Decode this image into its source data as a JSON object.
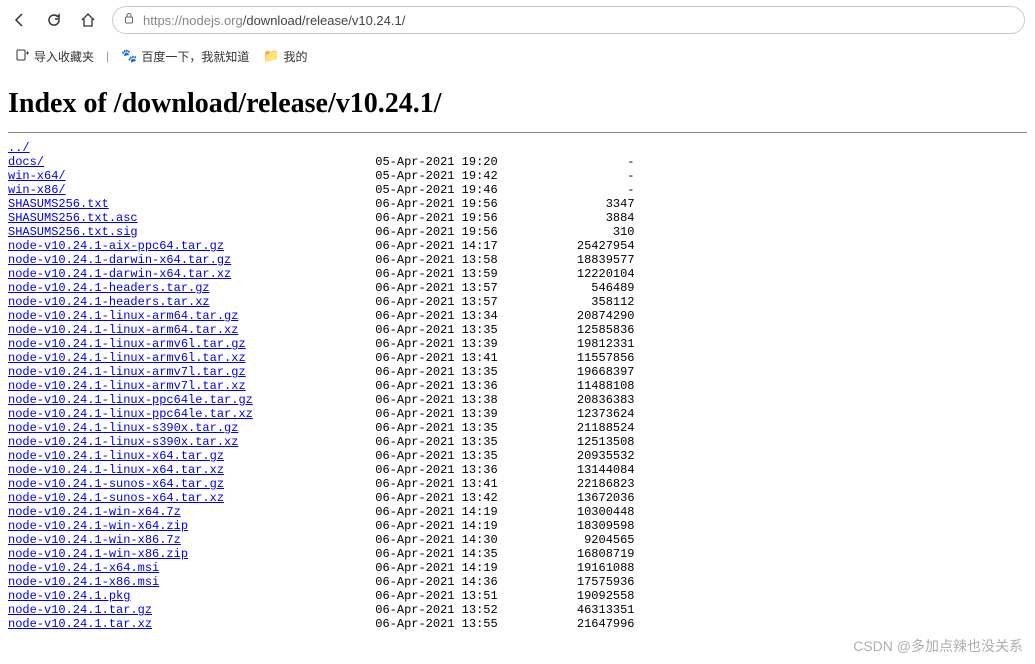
{
  "browser": {
    "url_host": "https://nodejs.org",
    "url_path": "/download/release/v10.24.1/"
  },
  "bookmarks": {
    "import_label": "导入收藏夹",
    "baidu_label": "百度一下，我就知道",
    "mine_label": "我的"
  },
  "page": {
    "title": "Index of /download/release/v10.24.1/"
  },
  "parent_link": "../",
  "files": [
    {
      "name": "docs/",
      "date": "05-Apr-2021 19:20",
      "size": "-"
    },
    {
      "name": "win-x64/",
      "date": "05-Apr-2021 19:42",
      "size": "-"
    },
    {
      "name": "win-x86/",
      "date": "05-Apr-2021 19:46",
      "size": "-"
    },
    {
      "name": "SHASUMS256.txt",
      "date": "06-Apr-2021 19:56",
      "size": "3347"
    },
    {
      "name": "SHASUMS256.txt.asc",
      "date": "06-Apr-2021 19:56",
      "size": "3884"
    },
    {
      "name": "SHASUMS256.txt.sig",
      "date": "06-Apr-2021 19:56",
      "size": "310"
    },
    {
      "name": "node-v10.24.1-aix-ppc64.tar.gz",
      "date": "06-Apr-2021 14:17",
      "size": "25427954"
    },
    {
      "name": "node-v10.24.1-darwin-x64.tar.gz",
      "date": "06-Apr-2021 13:58",
      "size": "18839577"
    },
    {
      "name": "node-v10.24.1-darwin-x64.tar.xz",
      "date": "06-Apr-2021 13:59",
      "size": "12220104"
    },
    {
      "name": "node-v10.24.1-headers.tar.gz",
      "date": "06-Apr-2021 13:57",
      "size": "546489"
    },
    {
      "name": "node-v10.24.1-headers.tar.xz",
      "date": "06-Apr-2021 13:57",
      "size": "358112"
    },
    {
      "name": "node-v10.24.1-linux-arm64.tar.gz",
      "date": "06-Apr-2021 13:34",
      "size": "20874290"
    },
    {
      "name": "node-v10.24.1-linux-arm64.tar.xz",
      "date": "06-Apr-2021 13:35",
      "size": "12585836"
    },
    {
      "name": "node-v10.24.1-linux-armv6l.tar.gz",
      "date": "06-Apr-2021 13:39",
      "size": "19812331"
    },
    {
      "name": "node-v10.24.1-linux-armv6l.tar.xz",
      "date": "06-Apr-2021 13:41",
      "size": "11557856"
    },
    {
      "name": "node-v10.24.1-linux-armv7l.tar.gz",
      "date": "06-Apr-2021 13:35",
      "size": "19668397"
    },
    {
      "name": "node-v10.24.1-linux-armv7l.tar.xz",
      "date": "06-Apr-2021 13:36",
      "size": "11488108"
    },
    {
      "name": "node-v10.24.1-linux-ppc64le.tar.gz",
      "date": "06-Apr-2021 13:38",
      "size": "20836383"
    },
    {
      "name": "node-v10.24.1-linux-ppc64le.tar.xz",
      "date": "06-Apr-2021 13:39",
      "size": "12373624"
    },
    {
      "name": "node-v10.24.1-linux-s390x.tar.gz",
      "date": "06-Apr-2021 13:35",
      "size": "21188524"
    },
    {
      "name": "node-v10.24.1-linux-s390x.tar.xz",
      "date": "06-Apr-2021 13:35",
      "size": "12513508"
    },
    {
      "name": "node-v10.24.1-linux-x64.tar.gz",
      "date": "06-Apr-2021 13:35",
      "size": "20935532"
    },
    {
      "name": "node-v10.24.1-linux-x64.tar.xz",
      "date": "06-Apr-2021 13:36",
      "size": "13144084"
    },
    {
      "name": "node-v10.24.1-sunos-x64.tar.gz",
      "date": "06-Apr-2021 13:41",
      "size": "22186823"
    },
    {
      "name": "node-v10.24.1-sunos-x64.tar.xz",
      "date": "06-Apr-2021 13:42",
      "size": "13672036"
    },
    {
      "name": "node-v10.24.1-win-x64.7z",
      "date": "06-Apr-2021 14:19",
      "size": "10300448"
    },
    {
      "name": "node-v10.24.1-win-x64.zip",
      "date": "06-Apr-2021 14:19",
      "size": "18309598"
    },
    {
      "name": "node-v10.24.1-win-x86.7z",
      "date": "06-Apr-2021 14:30",
      "size": "9204565"
    },
    {
      "name": "node-v10.24.1-win-x86.zip",
      "date": "06-Apr-2021 14:35",
      "size": "16808719"
    },
    {
      "name": "node-v10.24.1-x64.msi",
      "date": "06-Apr-2021 14:19",
      "size": "19161088"
    },
    {
      "name": "node-v10.24.1-x86.msi",
      "date": "06-Apr-2021 14:36",
      "size": "17575936"
    },
    {
      "name": "node-v10.24.1.pkg",
      "date": "06-Apr-2021 13:51",
      "size": "19092558"
    },
    {
      "name": "node-v10.24.1.tar.gz",
      "date": "06-Apr-2021 13:52",
      "size": "46313351"
    },
    {
      "name": "node-v10.24.1.tar.xz",
      "date": "06-Apr-2021 13:55",
      "size": "21647996"
    }
  ],
  "watermark": "CSDN @多加点辣也没关系"
}
